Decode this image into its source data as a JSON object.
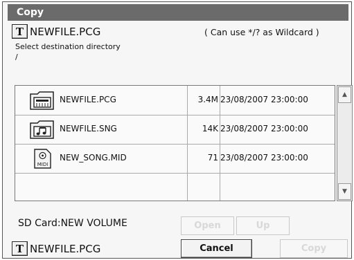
{
  "dialog": {
    "title": "Copy",
    "text_button_label": "T",
    "source_filename": "NEWFILE.PCG",
    "wildcard_hint": "( Can use */? as Wildcard )",
    "select_label": "Select destination directory",
    "current_path": "/"
  },
  "files": [
    {
      "name": "NEWFILE.PCG",
      "size": "3.4M",
      "date": "23/08/2007 23:00:00",
      "icon": "pcg-file-icon"
    },
    {
      "name": "NEWFILE.SNG",
      "size": "14K",
      "date": "23/08/2007 23:00:00",
      "icon": "song-file-icon"
    },
    {
      "name": "NEW_SONG.MID",
      "size": "71",
      "date": "23/08/2007 23:00:00",
      "icon": "midi-file-icon",
      "icon_text": "MIDI"
    }
  ],
  "scrollbar": {
    "up_arrow": "▲",
    "down_arrow": "▼"
  },
  "footer": {
    "volume": "SD Card:NEW VOLUME",
    "open_label": "Open",
    "up_label": "Up",
    "text_button_label": "T",
    "dest_filename": "NEWFILE.PCG",
    "cancel_label": "Cancel",
    "copy_label": "Copy"
  }
}
